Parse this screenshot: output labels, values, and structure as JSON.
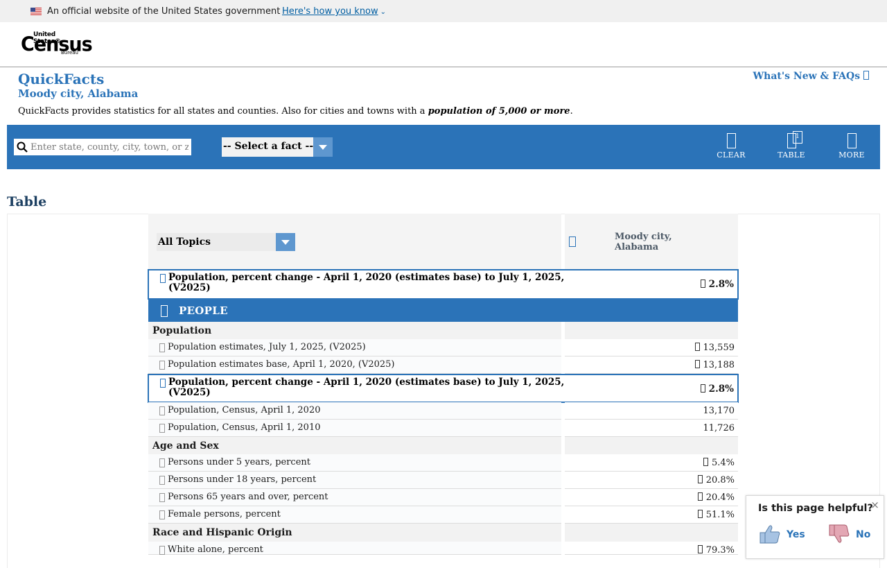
{
  "gov_banner": {
    "text": "An official website of the United States government",
    "link": "Here's how you know"
  },
  "logo": {
    "top": "United States®",
    "main": "Census",
    "sub": "Bureau"
  },
  "header": {
    "title": "QuickFacts",
    "subtitle": "Moody city, Alabama",
    "description_prefix": "QuickFacts provides statistics for all states and counties. Also for cities and towns with a",
    "description_emphasis": "population of 5,000 or more",
    "description_suffix": ".",
    "whats_new": "What's New & FAQs"
  },
  "toolbar": {
    "search_placeholder": "Enter state, county, city, town, or zip code",
    "fact_select": "-- Select a fact --",
    "clear": "CLEAR",
    "table": "TABLE",
    "table_badge": "1",
    "more": "MORE"
  },
  "table": {
    "heading": "Table",
    "topics_select": "All Topics",
    "location": "Moody city, Alabama",
    "featured": {
      "label_line1": "Population, percent change - April 1, 2020 (estimates base) to July 1, 2025,",
      "label_line2": "(V2025)",
      "value": "2.8%"
    },
    "section": "PEOPLE",
    "groups": [
      {
        "name": "Population",
        "rows": [
          {
            "label": "Population estimates, July 1, 2025, (V2025)",
            "value": "13,559"
          },
          {
            "label": "Population estimates base, April 1, 2020, (V2025)",
            "value": "13,188"
          },
          {
            "label_line1": "Population, percent change - April 1, 2020 (estimates base) to July 1, 2025,",
            "label_line2": "(V2025)",
            "value": "2.8%"
          },
          {
            "label": "Population, Census, April 1, 2020",
            "value": "13,170"
          },
          {
            "label": "Population, Census, April 1, 2010",
            "value": "11,726"
          }
        ]
      },
      {
        "name": "Age and Sex",
        "rows": [
          {
            "label": "Persons under 5 years, percent",
            "value": "5.4%"
          },
          {
            "label": "Persons under 18 years, percent",
            "value": "20.8%"
          },
          {
            "label": "Persons 65 years and over, percent",
            "value": "20.4%"
          },
          {
            "label": "Female persons, percent",
            "value": "51.1%"
          }
        ]
      },
      {
        "name": "Race and Hispanic Origin",
        "rows": [
          {
            "label": "White alone, percent",
            "value": "79.3%"
          }
        ]
      }
    ]
  },
  "feedback": {
    "question": "Is this page helpful?",
    "yes": "Yes",
    "no": "No",
    "close": "×"
  },
  "colors": {
    "brand_blue": "#2b73b8",
    "link_blue": "#2a73b8",
    "gov_link": "#005ea2"
  }
}
